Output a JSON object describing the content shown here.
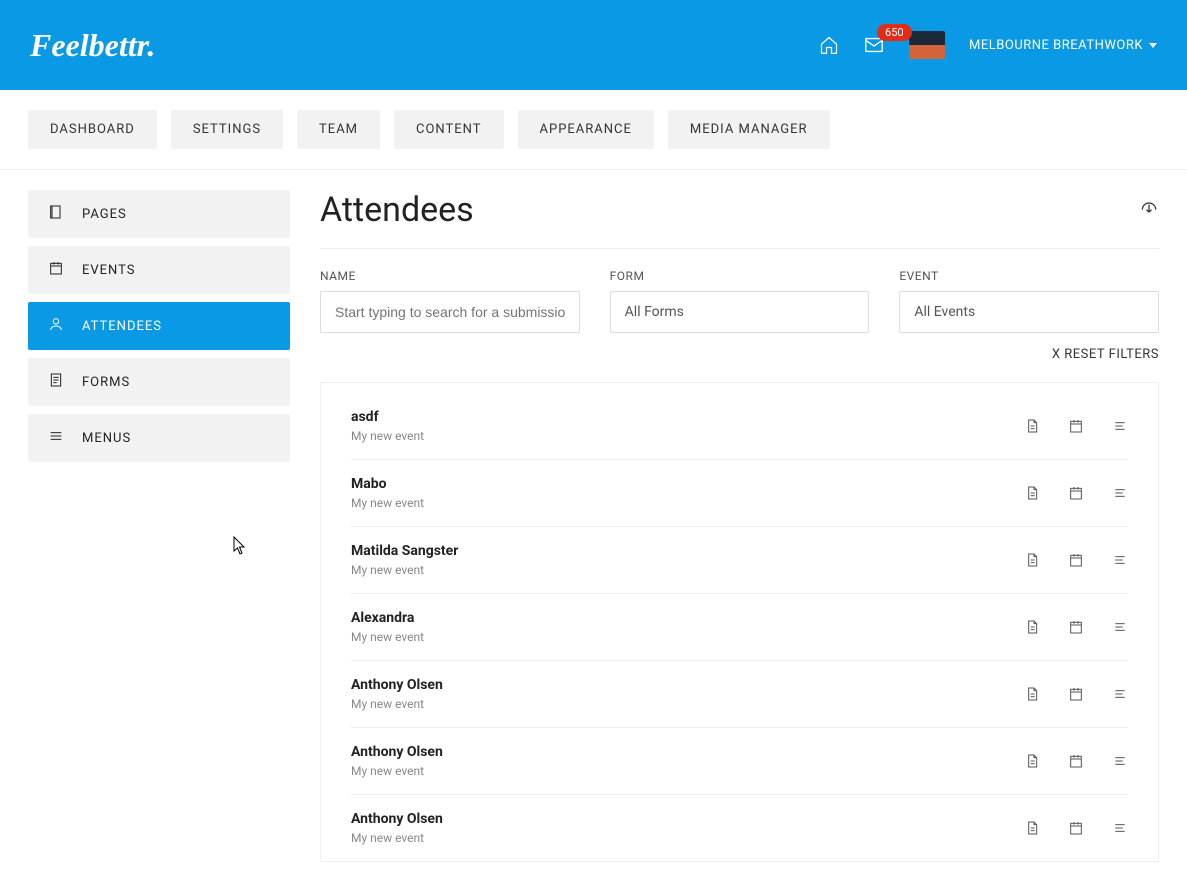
{
  "header": {
    "logo": "Feelbettr.",
    "mail_badge": "650",
    "account_name": "MELBOURNE BREATHWORK"
  },
  "topnav": [
    "DASHBOARD",
    "SETTINGS",
    "TEAM",
    "CONTENT",
    "APPEARANCE",
    "MEDIA MANAGER"
  ],
  "sidebar": [
    {
      "label": "PAGES",
      "icon": "page",
      "active": false
    },
    {
      "label": "EVENTS",
      "icon": "calendar",
      "active": false
    },
    {
      "label": "ATTENDEES",
      "icon": "person",
      "active": true
    },
    {
      "label": "FORMS",
      "icon": "form",
      "active": false
    },
    {
      "label": "MENUS",
      "icon": "menu",
      "active": false
    }
  ],
  "page": {
    "title": "Attendees",
    "reset_label": "X RESET FILTERS"
  },
  "filters": {
    "name": {
      "label": "NAME",
      "placeholder": "Start typing to search for a submission"
    },
    "form": {
      "label": "FORM",
      "value": "All Forms"
    },
    "event": {
      "label": "EVENT",
      "value": "All Events"
    }
  },
  "attendees": [
    {
      "name": "asdf",
      "event": "My new event"
    },
    {
      "name": "Mabo",
      "event": "My new event"
    },
    {
      "name": "Matilda Sangster",
      "event": "My new event"
    },
    {
      "name": "Alexandra",
      "event": "My new event"
    },
    {
      "name": "Anthony Olsen",
      "event": "My new event"
    },
    {
      "name": "Anthony Olsen",
      "event": "My new event"
    },
    {
      "name": "Anthony Olsen",
      "event": "My new event"
    }
  ]
}
